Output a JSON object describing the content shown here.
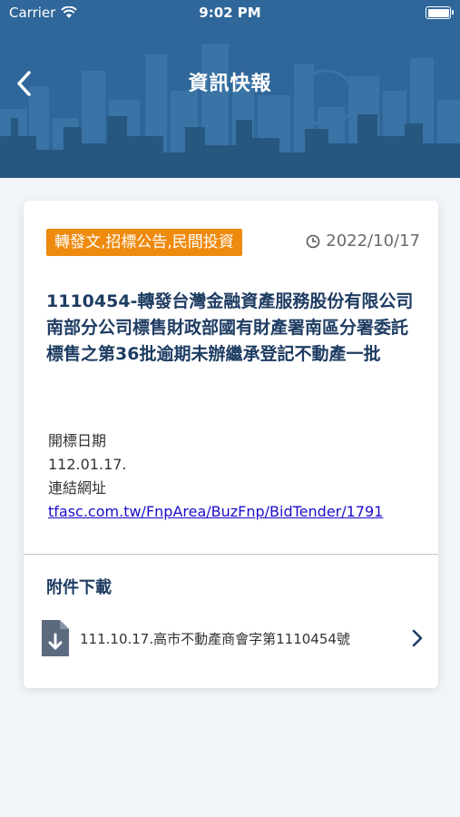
{
  "status_bar": {
    "carrier": "Carrier",
    "time": "9:02 PM"
  },
  "nav": {
    "title": "資訊快報",
    "back_icon": "chevron-left-icon"
  },
  "colors": {
    "header_bg": "#2f679a",
    "tag_bg": "#ee8a0e",
    "title_text": "#1e3c62",
    "link": "#1a0dcc",
    "page_bg": "#f1f4f9"
  },
  "article": {
    "category_tag": "轉發文,招標公告,民間投資",
    "date": "2022/10/17",
    "title": "1110454-轉發台灣金融資產服務股份有限公司南部分公司標售財政部國有財產署南區分署委託標售之第36批逾期未辦繼承登記不動產一批",
    "body": {
      "bid_date_label": "開標日期",
      "bid_date_value": "112.01.17.",
      "link_label": "連結網址",
      "link_text": "tfasc.com.tw/FnpArea/BuzFnp/BidTender/1791"
    }
  },
  "attachments": {
    "title": "附件下載",
    "items": [
      {
        "label": "111.10.17.高市不動產商會字第1110454號",
        "icon": "file-download-icon"
      }
    ]
  }
}
